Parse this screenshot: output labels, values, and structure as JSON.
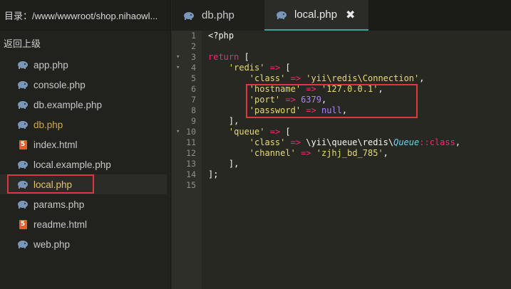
{
  "sidebar": {
    "dir_label": "目录：/www/wwwroot/shop.nihaowl...",
    "back_label": "返回上级",
    "files": [
      {
        "name": "app.php",
        "type": "php",
        "state": "normal"
      },
      {
        "name": "console.php",
        "type": "php",
        "state": "normal"
      },
      {
        "name": "db.example.php",
        "type": "php",
        "state": "normal"
      },
      {
        "name": "db.php",
        "type": "php",
        "state": "open"
      },
      {
        "name": "index.html",
        "type": "html",
        "state": "normal"
      },
      {
        "name": "local.example.php",
        "type": "php",
        "state": "normal"
      },
      {
        "name": "local.php",
        "type": "php",
        "state": "active"
      },
      {
        "name": "params.php",
        "type": "php",
        "state": "normal"
      },
      {
        "name": "readme.html",
        "type": "html",
        "state": "normal"
      },
      {
        "name": "web.php",
        "type": "php",
        "state": "normal"
      }
    ]
  },
  "tabs": [
    {
      "label": "db.php",
      "active": false
    },
    {
      "label": "local.php",
      "active": true,
      "close": "✖"
    }
  ],
  "editor": {
    "line_numbers": [
      "1",
      "2",
      "3",
      "4",
      "5",
      "6",
      "7",
      "8",
      "9",
      "10",
      "11",
      "12",
      "13",
      "14",
      "15"
    ],
    "lines": [
      "<?php",
      "",
      "return [",
      "    'redis' => [",
      "        'class' => 'yii\\redis\\Connection',",
      "        'hostname' => '127.0.0.1',",
      "        'port' => 6379,",
      "        'password' => null,",
      "    ],",
      "    'queue' => [",
      "        'class' => \\yii\\queue\\redis\\Queue::class,",
      "        'channel' => 'zjhj_bd_785',",
      "    ],",
      "];",
      ""
    ]
  },
  "colors": {
    "background": "#272822",
    "sidebar_bg": "#21221d",
    "keyword": "#f92672",
    "string": "#e6db74",
    "number": "#ae81ff",
    "highlight_box": "#e0363f",
    "tab_accent": "#3aa6a0"
  },
  "icons": {
    "php_file": "elephant-icon",
    "html_file": "html5-icon",
    "close": "close-icon"
  }
}
